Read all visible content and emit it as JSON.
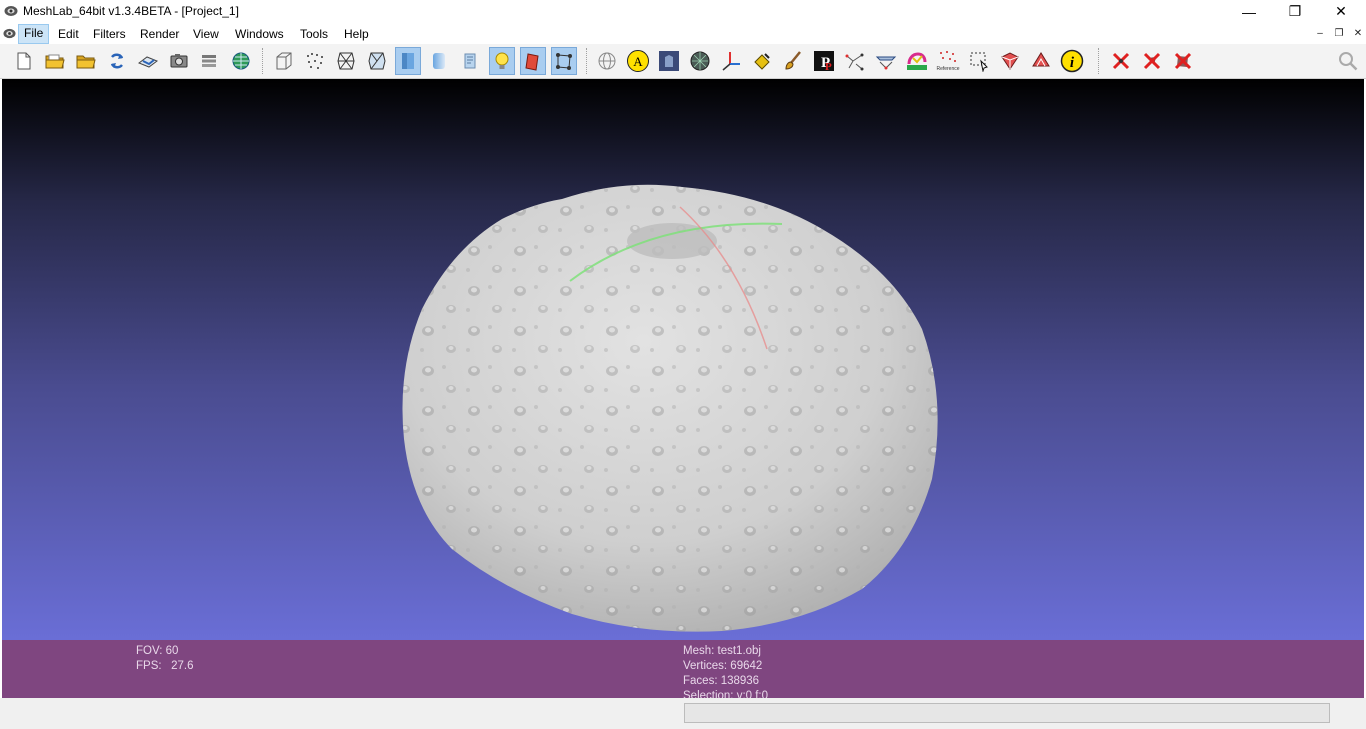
{
  "window": {
    "title": "MeshLab_64bit v1.3.4BETA - [Project_1]",
    "controls": {
      "minimize": "—",
      "restore": "❐",
      "close": "✕"
    }
  },
  "menu": {
    "items": [
      "File",
      "Edit",
      "Filters",
      "Render",
      "View",
      "Windows",
      "Tools",
      "Help"
    ],
    "active": "File",
    "mdi_controls": {
      "minimize": "–",
      "restore": "❐",
      "close": "✕"
    }
  },
  "toolbar": {
    "groups": [
      [
        "new-project-icon",
        "open-project-icon",
        "import-mesh-icon",
        "reload-icon",
        "export-mesh-icon",
        "snapshot-icon",
        "layers-icon",
        "globe-icon"
      ],
      [
        "bounding-box-icon",
        "points-icon",
        "wireframe-icon",
        "hiddenlines-icon",
        "flat-icon",
        "smooth-icon",
        "texture-icon",
        "light-icon",
        "face-normals-icon",
        "vertex-normals-icon"
      ],
      [
        "manipulator-icon",
        "label-icon",
        "texture-param-icon",
        "painted-mesh-icon",
        "axis-icon",
        "paint-bucket-icon",
        "brush-icon",
        "pickpoints-icon",
        "align-icon",
        "measure-icon",
        "quality-icon",
        "reference-icon",
        "select-vertices-icon",
        "select-faces-icon",
        "select-connected-icon",
        "info-icon"
      ],
      [
        "delete-vertices-icon",
        "delete-faces-icon",
        "delete-all-icon"
      ]
    ],
    "checked": [
      "flat-icon",
      "light-icon",
      "face-normals-icon",
      "vertex-normals-icon"
    ],
    "search_icon": "search-icon",
    "reference_caption": "Reference"
  },
  "viewport": {
    "background_top": "#000000",
    "background_bottom": "#6a6ed6",
    "mesh_color": "#c8c8c8",
    "trackball_colors": {
      "horizontal": "#7fe07a",
      "vertical": "#e88a8a"
    }
  },
  "info": {
    "fov": "FOV: 60",
    "fps": "FPS:   27.6",
    "mesh": "Mesh: test1.obj",
    "vertices": "Vertices: 69642",
    "faces": "Faces: 138936",
    "selection": "Selection: v:0 f:0"
  },
  "status": {
    "progress": 0.0,
    "progress_color": "#06b025"
  }
}
